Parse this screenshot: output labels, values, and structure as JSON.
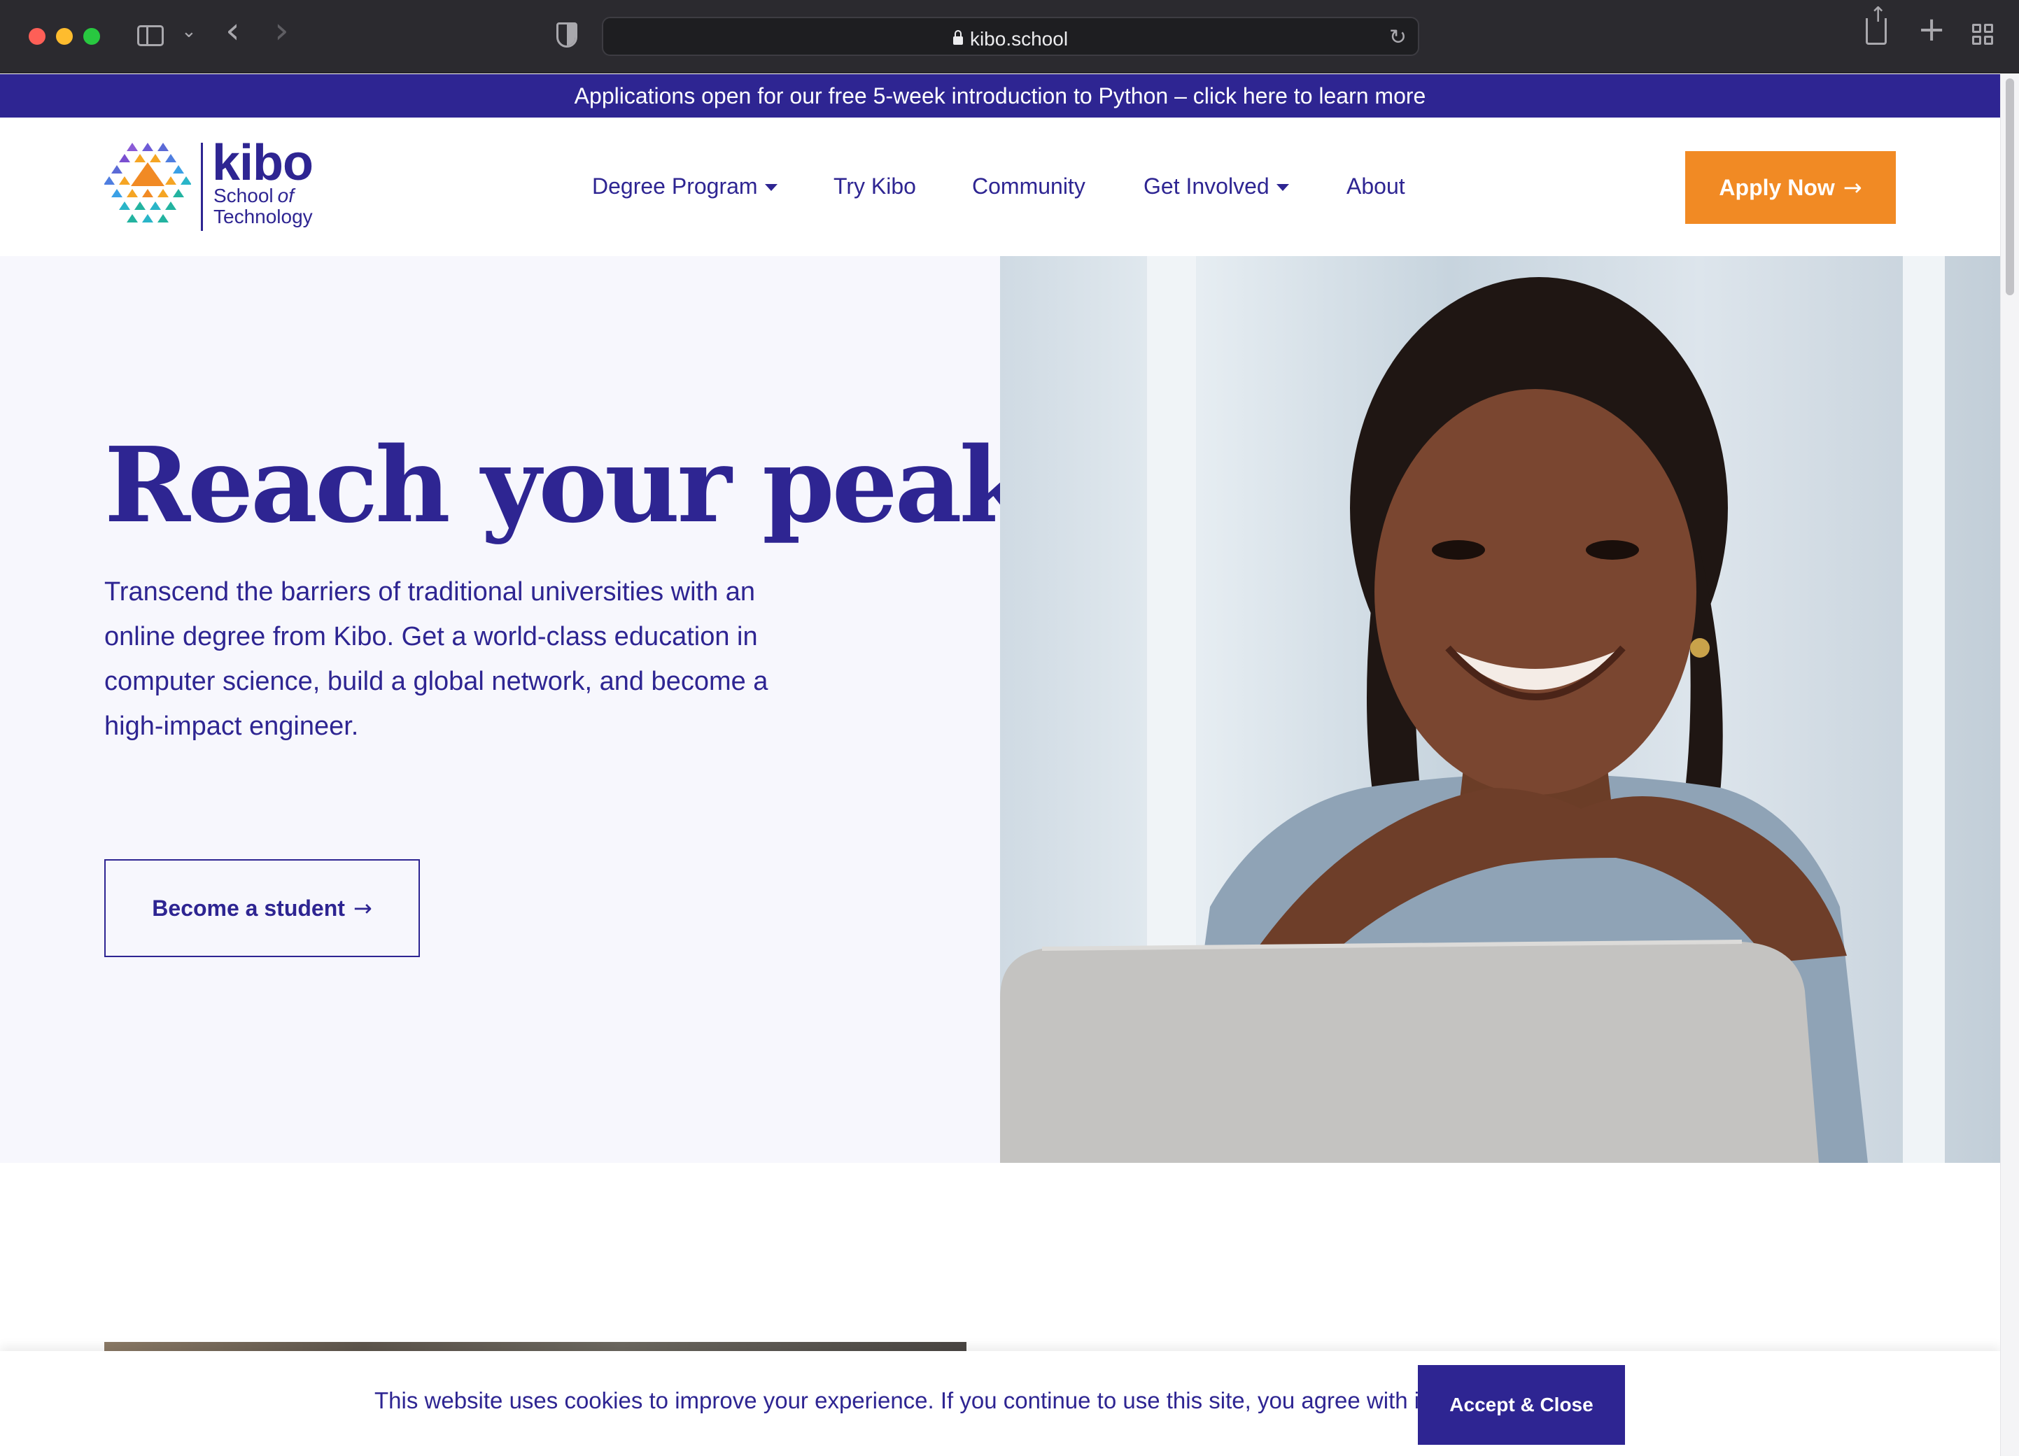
{
  "browser": {
    "url": "kibo.school",
    "icons": [
      "sidebar-icon",
      "chevron-down-icon",
      "back-icon",
      "forward-icon",
      "shield-icon",
      "lock-icon",
      "reload-icon",
      "share-icon",
      "new-tab-icon",
      "tab-overview-icon"
    ]
  },
  "announcement": {
    "text": "Applications open for our free 5-week introduction to Python – click here to learn more"
  },
  "header": {
    "logo": {
      "name": "kibo",
      "sub_school": "School",
      "sub_of": "of",
      "sub_tech": "Technology"
    },
    "nav": [
      {
        "label": "Degree Program",
        "dropdown": true
      },
      {
        "label": "Try Kibo",
        "dropdown": false
      },
      {
        "label": "Community",
        "dropdown": false
      },
      {
        "label": "Get Involved",
        "dropdown": true
      },
      {
        "label": "About",
        "dropdown": false
      }
    ],
    "apply_label": "Apply Now",
    "arrow_glyph": "→"
  },
  "hero": {
    "title": "Reach your peak.",
    "text": "Transcend the barriers of traditional universities with an online degree from Kibo. Get a world-class education in computer science, build a global network, and become a high-impact engineer.",
    "cta_label": "Become a student"
  },
  "cookie": {
    "text": "This website uses cookies to improve your experience. If you continue to use this site, you agree with it.",
    "button_label": "Accept & Close"
  },
  "colors": {
    "brand_purple": "#2e2592",
    "accent_orange": "#f18a24",
    "hero_bg": "#f7f7fd"
  }
}
